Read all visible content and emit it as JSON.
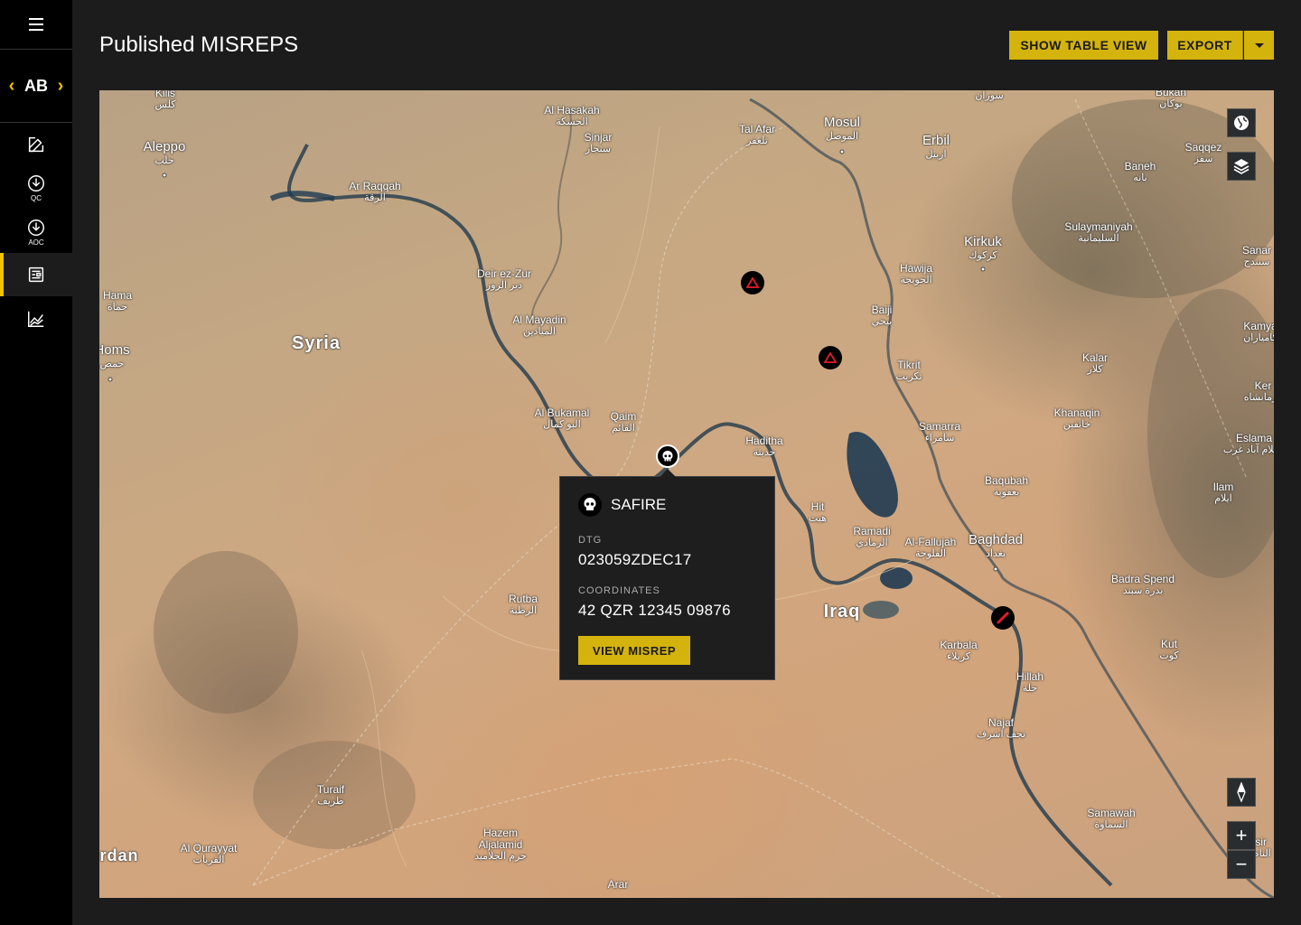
{
  "sidebar": {
    "menu_icon": "hamburger-menu-icon",
    "switcher": {
      "code": "AB",
      "prev_icon": "chevron-left-icon",
      "next_icon": "chevron-right-icon"
    },
    "items": [
      {
        "name": "edit",
        "icon": "edit-icon",
        "sub": ""
      },
      {
        "name": "qc",
        "icon": "download-circle-icon",
        "sub": "QC"
      },
      {
        "name": "aoc",
        "icon": "download-circle-icon",
        "sub": "AOC"
      },
      {
        "name": "misreps",
        "icon": "report-icon",
        "sub": "",
        "active": true
      },
      {
        "name": "analytics",
        "icon": "line-chart-icon",
        "sub": ""
      }
    ]
  },
  "header": {
    "title": "Published MISREPS",
    "table_view_label": "SHOW TABLE VIEW",
    "export_label": "EXPORT"
  },
  "map": {
    "labels": [
      {
        "id": "kilis",
        "en": "Kilis",
        "ar": "كلس"
      },
      {
        "id": "hasakah",
        "en": "Al Hasakah",
        "ar": "الحسكة"
      },
      {
        "id": "aleppo",
        "en": "Aleppo",
        "ar": "حلب"
      },
      {
        "id": "sinjar",
        "en": "Sinjar",
        "ar": "سنجار"
      },
      {
        "id": "talafar",
        "en": "Tal Afar",
        "ar": "تلعفر"
      },
      {
        "id": "mosul",
        "en": "Mosul",
        "ar": "الموصل"
      },
      {
        "id": "erbil",
        "en": "Erbil",
        "ar": "اربيل"
      },
      {
        "id": "soran",
        "en": "",
        "ar": "سوران"
      },
      {
        "id": "bukan",
        "en": "Bukan",
        "ar": "بوكان"
      },
      {
        "id": "saqqez",
        "en": "Saqqez",
        "ar": "سقز"
      },
      {
        "id": "baneh",
        "en": "Baneh",
        "ar": "بانه"
      },
      {
        "id": "raqqah",
        "en": "Ar Raqqah",
        "ar": "الرقة"
      },
      {
        "id": "kirkuk",
        "en": "Kirkuk",
        "ar": "كركوك"
      },
      {
        "id": "sulay",
        "en": "Sulaymaniyah",
        "ar": "السليمانية"
      },
      {
        "id": "sanandaj",
        "en": "Sanar",
        "ar": "سنندج"
      },
      {
        "id": "deir",
        "en": "Deir ez-Zur",
        "ar": "دير الزور"
      },
      {
        "id": "hawija",
        "en": "Hawija",
        "ar": "الحويجة"
      },
      {
        "id": "hama",
        "en": "Hama",
        "ar": "حماة"
      },
      {
        "id": "mayadin",
        "en": "Al Mayadin",
        "ar": "الميادين"
      },
      {
        "id": "baiji",
        "en": "Baiji",
        "ar": "بيجي"
      },
      {
        "id": "kamyaran",
        "en": "Kamya",
        "ar": "کامیاران"
      },
      {
        "id": "homs",
        "en": "Homs",
        "ar": "حمص"
      },
      {
        "id": "syria",
        "en": "Syria",
        "ar": ""
      },
      {
        "id": "tikrit",
        "en": "Tikrit",
        "ar": "تكريت"
      },
      {
        "id": "kalar",
        "en": "Kalar",
        "ar": "كلار"
      },
      {
        "id": "kermanshah",
        "en": "Ker",
        "ar": "کرمانشاه"
      },
      {
        "id": "bukamal",
        "en": "Al Bukamal",
        "ar": "البو كمال"
      },
      {
        "id": "qaim",
        "en": "Qaim",
        "ar": "القائم"
      },
      {
        "id": "khanaqin",
        "en": "Khanaqin",
        "ar": "خانقين"
      },
      {
        "id": "samarra",
        "en": "Samarra",
        "ar": "سامراء"
      },
      {
        "id": "eslamabad",
        "en": "Eslama",
        "ar": "اسلام آباد غرب"
      },
      {
        "id": "haditha",
        "en": "Haditha",
        "ar": "حديثة"
      },
      {
        "id": "baqubah",
        "en": "Baqubah",
        "ar": "بعقوبة"
      },
      {
        "id": "ilam",
        "en": "Ilam",
        "ar": "ایلام"
      },
      {
        "id": "hit",
        "en": "Hit",
        "ar": "هيت"
      },
      {
        "id": "ramadi",
        "en": "Ramadi",
        "ar": "الرمادي"
      },
      {
        "id": "fallujah",
        "en": "Al-Fallujah",
        "ar": "الفلوجة"
      },
      {
        "id": "baghdad",
        "en": "Baghdad",
        "ar": "بغداد"
      },
      {
        "id": "badra",
        "en": "Badra Spend",
        "ar": "بدرة سبند"
      },
      {
        "id": "rutba",
        "en": "Rutba",
        "ar": "الرطبة"
      },
      {
        "id": "iraq",
        "en": "Iraq",
        "ar": ""
      },
      {
        "id": "karbala",
        "en": "Karbala",
        "ar": "كربلاء"
      },
      {
        "id": "kut",
        "en": "Kut",
        "ar": "كوت"
      },
      {
        "id": "hillah",
        "en": "Hillah",
        "ar": "حلة"
      },
      {
        "id": "najaf",
        "en": "Najaf",
        "ar": "نجف اشرف"
      },
      {
        "id": "turaif",
        "en": "Turaif",
        "ar": "طريف"
      },
      {
        "id": "samawah",
        "en": "Samawah",
        "ar": "السماوة"
      },
      {
        "id": "hazem",
        "en": "Hazem Aljalamid",
        "ar": "حزم الجلاميد"
      },
      {
        "id": "qurayyat",
        "en": "Al Qurayyat",
        "ar": "القريات"
      },
      {
        "id": "nasiriyah",
        "en": "Nasir",
        "ar": "الناصرية"
      },
      {
        "id": "jordan",
        "en": "rdan",
        "ar": ""
      },
      {
        "id": "arar",
        "en": "Arar",
        "ar": ""
      }
    ],
    "markers": [
      {
        "id": "marker-1",
        "type": "triangle",
        "icon": "warning-triangle-icon"
      },
      {
        "id": "marker-2",
        "type": "triangle",
        "icon": "warning-triangle-icon"
      },
      {
        "id": "marker-3",
        "type": "skull",
        "icon": "skull-icon"
      },
      {
        "id": "marker-4",
        "type": "slash",
        "icon": "slash-icon"
      }
    ],
    "controls": {
      "globe_icon": "globe-icon",
      "layers_icon": "layers-icon",
      "compass_icon": "compass-icon",
      "zoom_in": "+",
      "zoom_out": "−"
    }
  },
  "popup": {
    "type_icon": "skull-icon",
    "type": "SAFIRE",
    "dtg_label": "DTG",
    "dtg": "023059ZDEC17",
    "coords_label": "COORDINATES",
    "coords": "42 QZR 12345 09876",
    "button_label": "VIEW MISREP"
  },
  "colors": {
    "accent": "#d4b30c",
    "background": "#1c1c1c",
    "sidebar": "#000000",
    "marker": "#e21d2c"
  }
}
